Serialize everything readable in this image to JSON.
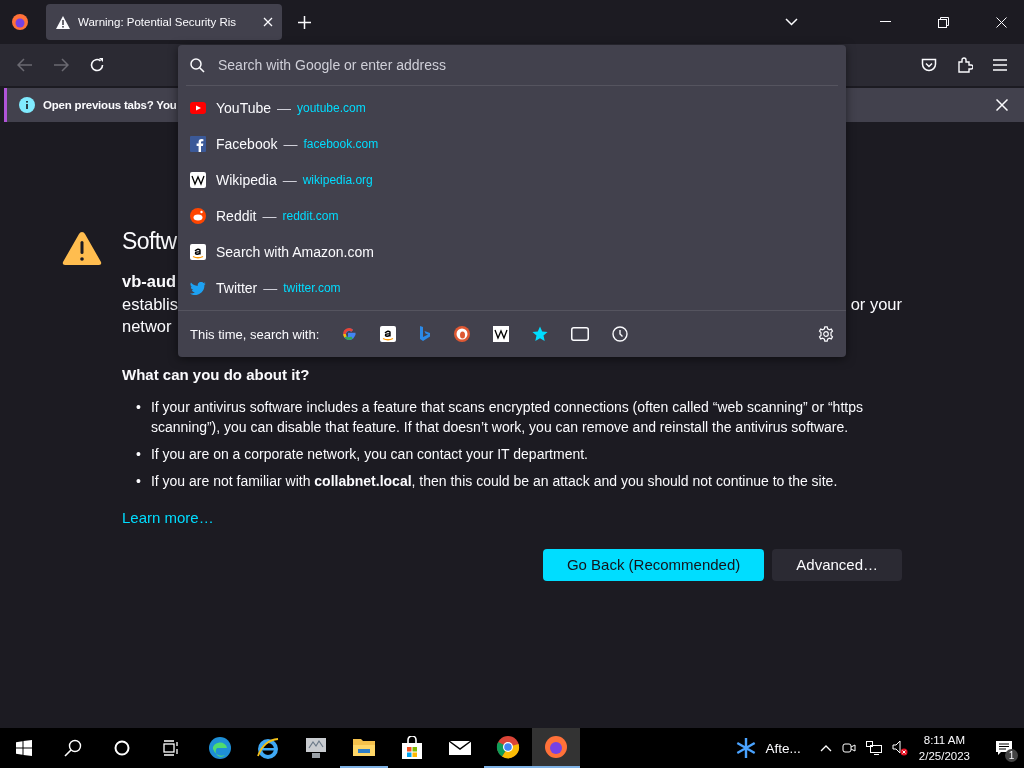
{
  "tab": {
    "title": "Warning: Potential Security Ris",
    "selected": true
  },
  "toolbar": {
    "back_disabled": true,
    "forward_disabled": true
  },
  "address_bar": {
    "placeholder": "Search with Google or enter address"
  },
  "suggestions": [
    {
      "kind": "site",
      "title": "YouTube",
      "separator": "—",
      "url": "youtube.com"
    },
    {
      "kind": "site",
      "title": "Facebook",
      "separator": "—",
      "url": "facebook.com"
    },
    {
      "kind": "site",
      "title": "Wikipedia",
      "separator": "—",
      "url": "wikipedia.org"
    },
    {
      "kind": "site",
      "title": "Reddit",
      "separator": "—",
      "url": "reddit.com"
    },
    {
      "kind": "search",
      "title": "Search with Amazon.com"
    },
    {
      "kind": "site",
      "title": "Twitter",
      "separator": "—",
      "url": "twitter.com"
    }
  ],
  "search_with": {
    "label": "This time, search with:"
  },
  "notification": {
    "text": "Open previous tabs? You"
  },
  "page": {
    "heading": "Softw",
    "intro_lines": [
      "vb-aud",
      "establis",
      "networ"
    ],
    "intro_right": "or your",
    "section_title": "What can you do about it?",
    "bullets": [
      {
        "marker": "•",
        "text": "If your antivirus software includes a feature that scans encrypted connections (often called “web scanning” or “https scanning”), you can disable that feature. If that doesn’t work, you can remove and reinstall the antivirus software."
      },
      {
        "marker": "•",
        "text": "If you are on a corporate network, you can contact your IT department."
      },
      {
        "marker": "•",
        "text": "If you are not familiar with **collabnet.local**, then this could be an attack and you should not continue to the site."
      }
    ],
    "link": "Learn more…",
    "buttons": [
      {
        "label": "Go Back (Recommended)",
        "primary": true
      },
      {
        "label": "Advanced…",
        "primary": false
      }
    ]
  },
  "taskbar": {
    "apps": [
      {
        "running": false,
        "selected": false
      },
      {
        "running": false,
        "selected": false
      },
      {
        "running": false,
        "selected": false
      },
      {
        "running": true,
        "selected": false
      },
      {
        "running": false,
        "selected": false
      },
      {
        "running": false,
        "selected": false
      },
      {
        "running": true,
        "selected": false
      },
      {
        "running": true,
        "selected": true
      }
    ],
    "weather": "Afte...",
    "time": "8:11 AM",
    "date": "2/25/2023",
    "notifications": "1"
  }
}
